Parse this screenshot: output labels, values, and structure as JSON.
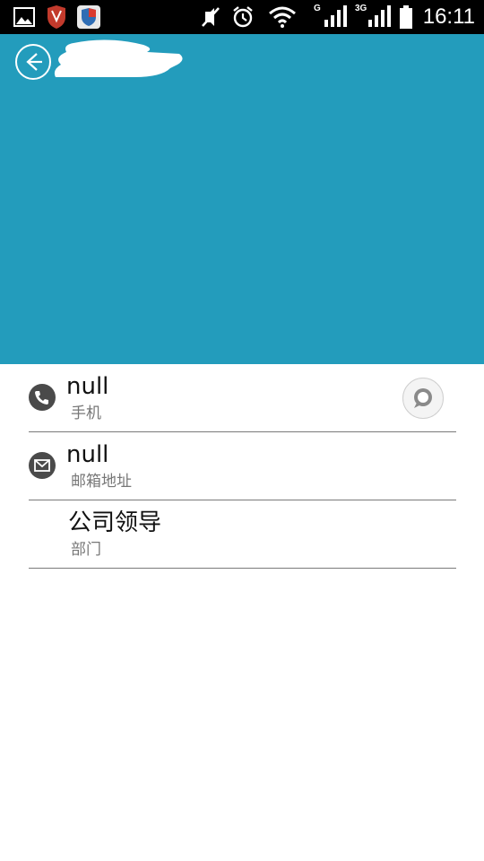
{
  "status_bar": {
    "time": "16:11",
    "network_1": "G",
    "network_2": "3G",
    "icons": [
      "gallery-icon",
      "shield-app-icon",
      "security-app-icon",
      "mute-icon",
      "alarm-icon",
      "wifi-icon",
      "signal-icon",
      "signal-3g-icon",
      "battery-icon"
    ]
  },
  "header": {
    "background_color": "#239cbc",
    "back_icon": "back-arrow-icon"
  },
  "fields": [
    {
      "value": "null",
      "label": "手机",
      "icon": "phone-icon",
      "action_icon": "chat-bubble-icon"
    },
    {
      "value": "null",
      "label": "邮箱地址",
      "icon": "mail-icon"
    },
    {
      "value": "公司领导",
      "label": "部门"
    }
  ]
}
